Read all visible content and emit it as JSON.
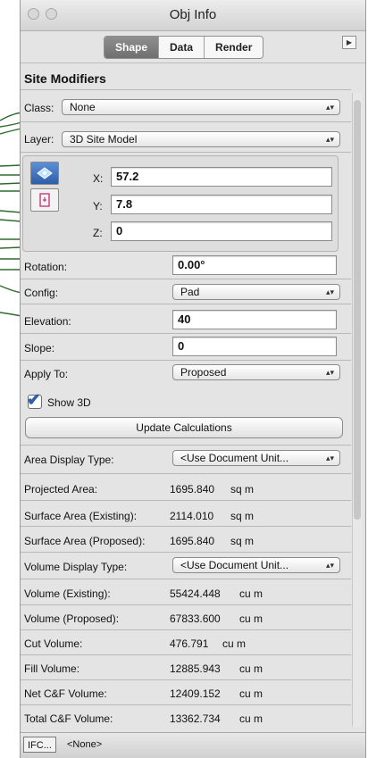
{
  "window": {
    "title": "Obj Info"
  },
  "tabs": [
    {
      "label": "Shape",
      "active": true
    },
    {
      "label": "Data",
      "active": false
    },
    {
      "label": "Render",
      "active": false
    }
  ],
  "section": {
    "title": "Site Modifiers"
  },
  "class": {
    "label": "Class:",
    "value": "None"
  },
  "layer": {
    "label": "Layer:",
    "value": "3D Site Model"
  },
  "coords": {
    "x_label": "X:",
    "x_value": "57.2",
    "y_label": "Y:",
    "y_value": "7.8",
    "z_label": "Z:",
    "z_value": "0"
  },
  "fields": {
    "rotation_label": "Rotation:",
    "rotation_value": "0.00°",
    "config_label": "Config:",
    "config_value": "Pad",
    "elevation_label": "Elevation:",
    "elevation_value": "40",
    "slope_label": "Slope:",
    "slope_value": "0",
    "apply_label": "Apply To:",
    "apply_value": "Proposed"
  },
  "show3d": {
    "label": "Show 3D",
    "checked": true
  },
  "update_button": "Update Calculations",
  "area": {
    "display_label": "Area Display Type:",
    "display_value": "<Use Document Unit...",
    "rows": [
      {
        "label": "Projected Area:",
        "value": "1695.840",
        "unit": "sq m"
      },
      {
        "label": "Surface Area (Existing):",
        "value": "2114.010",
        "unit": "sq m"
      },
      {
        "label": "Surface Area (Proposed):",
        "value": "1695.840",
        "unit": "sq m"
      }
    ]
  },
  "volume": {
    "display_label": "Volume Display Type:",
    "display_value": "<Use Document Unit...",
    "rows": [
      {
        "label": "Volume (Existing):",
        "value": "55424.448",
        "unit": "cu m"
      },
      {
        "label": "Volume (Proposed):",
        "value": "67833.600",
        "unit": "cu m"
      },
      {
        "label": "Cut Volume:",
        "value": "476.791",
        "unit": "cu m"
      },
      {
        "label": "Fill Volume:",
        "value": "12885.943",
        "unit": "cu m"
      },
      {
        "label": "Net C&F Volume:",
        "value": "12409.152",
        "unit": "cu m"
      },
      {
        "label": "Total C&F Volume:",
        "value": "13362.734",
        "unit": "cu m"
      }
    ]
  },
  "status": {
    "ifc_label": "IFC...",
    "value": "<None>"
  },
  "colors": {
    "accent": "#2f5ea8",
    "drawing_lines": "#2f6b2f"
  }
}
